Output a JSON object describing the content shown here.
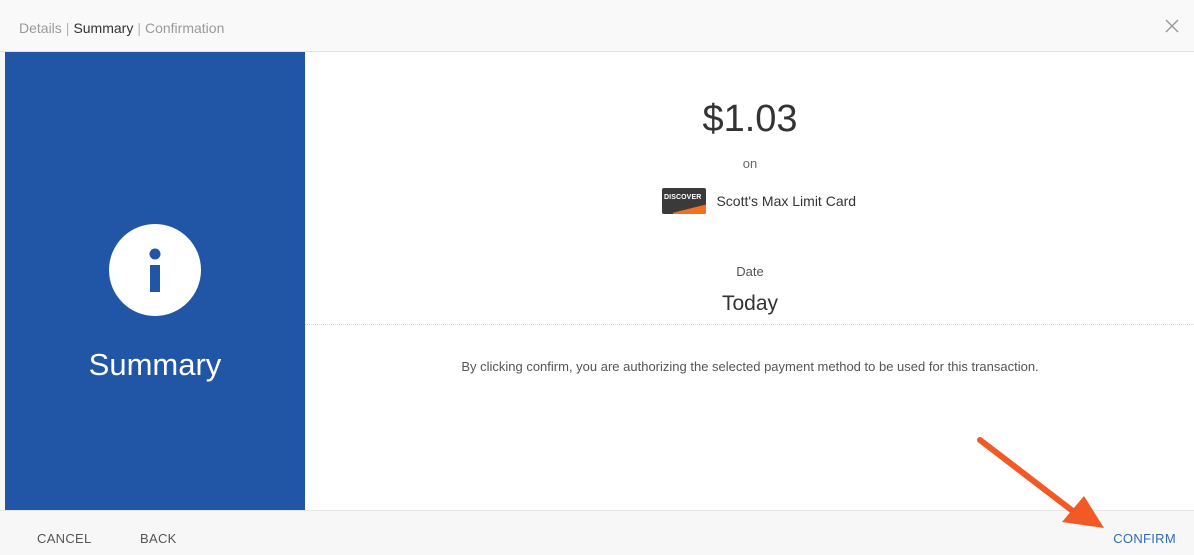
{
  "header": {
    "steps": [
      "Details",
      "Summary",
      "Confirmation"
    ],
    "active_step": "Summary",
    "separator": "|",
    "close_icon": "close-icon"
  },
  "side_panel": {
    "icon": "info-icon",
    "title": "Summary",
    "background_color": "#2156a6"
  },
  "summary": {
    "amount": "$1.03",
    "on_text": "on",
    "card": {
      "brand": "DISCOVER",
      "logo_icon": "discover-card-icon",
      "name": "Scott's Max Limit Card"
    },
    "date_label": "Date",
    "date_value": "Today",
    "disclaimer": "By clicking confirm, you are authorizing the selected payment method to be used for this transaction."
  },
  "footer": {
    "cancel_label": "CANCEL",
    "back_label": "BACK",
    "confirm_label": "CONFIRM",
    "confirm_color": "#2f6db5"
  },
  "annotation": {
    "icon": "arrow-annotation-icon",
    "color": "#f15a24"
  }
}
